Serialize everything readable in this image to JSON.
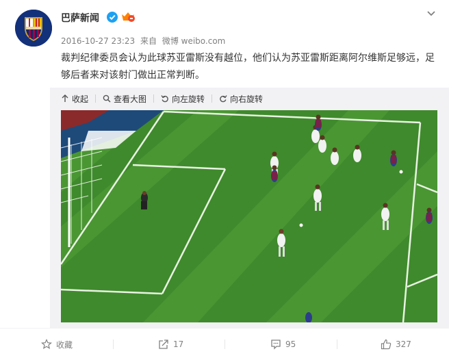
{
  "post": {
    "author": "巴萨新闻",
    "date": "2016-10-27 23:23",
    "source_prefix": "来自",
    "source": "微博 weibo.com",
    "text": "裁判纪律委员会认为此球苏亚雷斯没有越位，他们认为苏亚雷斯距离阿尔维斯足够远，足够后者来对该射门做出正常判断。"
  },
  "media_toolbar": {
    "collapse": "收起",
    "view_large": "查看大图",
    "rotate_left": "向左旋转",
    "rotate_right": "向右旋转"
  },
  "footer": {
    "favorite_label": "收藏",
    "repost_count": "17",
    "comment_count": "95",
    "like_count": "327"
  },
  "colors": {
    "verified": "#1da1f2",
    "pitch_green": "#3f8a2c",
    "link_orange": "#eb7350",
    "meta_gray": "#808080"
  }
}
